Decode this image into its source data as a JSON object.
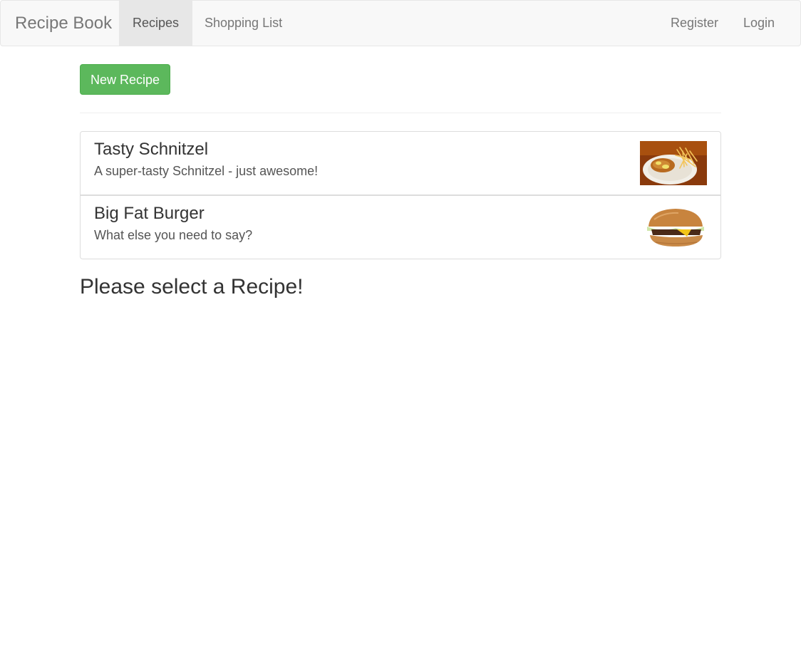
{
  "navbar": {
    "brand": "Recipe Book",
    "links": {
      "recipes": "Recipes",
      "shopping_list": "Shopping List",
      "register": "Register",
      "login": "Login"
    },
    "active": "recipes"
  },
  "toolbar": {
    "new_recipe_label": "New Recipe"
  },
  "recipes": [
    {
      "name": "Tasty Schnitzel",
      "description": "A super-tasty Schnitzel - just awesome!",
      "image_icon": "schnitzel-plate-photo"
    },
    {
      "name": "Big Fat Burger",
      "description": "What else you need to say?",
      "image_icon": "burger-photo"
    }
  ],
  "detail": {
    "placeholder": "Please select a Recipe!"
  },
  "colors": {
    "success": "#5cb85c",
    "navbar_bg": "#f8f8f8",
    "active_tab": "#e7e7e7"
  }
}
